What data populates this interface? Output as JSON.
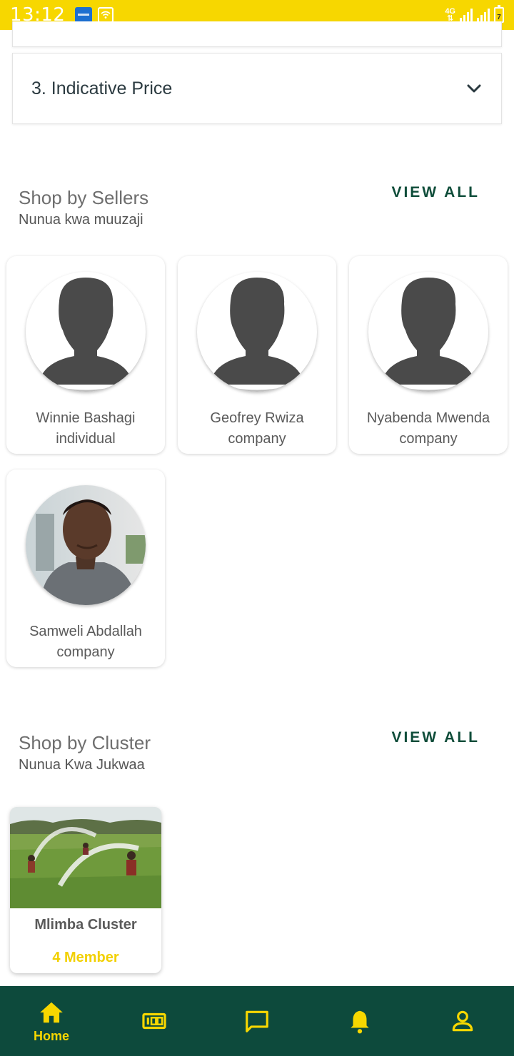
{
  "status_bar": {
    "time": "13:12",
    "network": "4G",
    "battery": "7"
  },
  "accordion": {
    "title": "3. Indicative Price"
  },
  "sellers_section": {
    "title": "Shop by Sellers",
    "subtitle": "Nunua kwa muuzaji",
    "view_all": "VIEW ALL",
    "items": [
      {
        "name": "Winnie  Bashagi",
        "type": "individual",
        "avatar": "placeholder-person-icon"
      },
      {
        "name": "Geofrey Rwiza",
        "type": "company",
        "avatar": "placeholder-person-icon"
      },
      {
        "name": "Nyabenda Mwenda",
        "type": "company",
        "avatar": "placeholder-person-icon"
      },
      {
        "name": "Samweli Abdallah",
        "type": "company",
        "avatar": "profile-photo"
      }
    ]
  },
  "cluster_section": {
    "title": "Shop by Cluster",
    "subtitle": "Nunua Kwa Jukwaa",
    "view_all": "VIEW ALL",
    "items": [
      {
        "name": "Mlimba Cluster",
        "members": "4 Member"
      }
    ]
  },
  "bottom_nav": {
    "items": [
      {
        "label": "Home",
        "icon": "home-icon",
        "active": true
      },
      {
        "label": "",
        "icon": "dashboard-icon",
        "active": false
      },
      {
        "label": "",
        "icon": "chat-icon",
        "active": false
      },
      {
        "label": "",
        "icon": "bell-icon",
        "active": false
      },
      {
        "label": "",
        "icon": "profile-icon",
        "active": false
      }
    ]
  },
  "colors": {
    "brand_yellow": "#f7d700",
    "brand_green": "#0d4a3c",
    "view_all_green": "#0f4d3a"
  }
}
